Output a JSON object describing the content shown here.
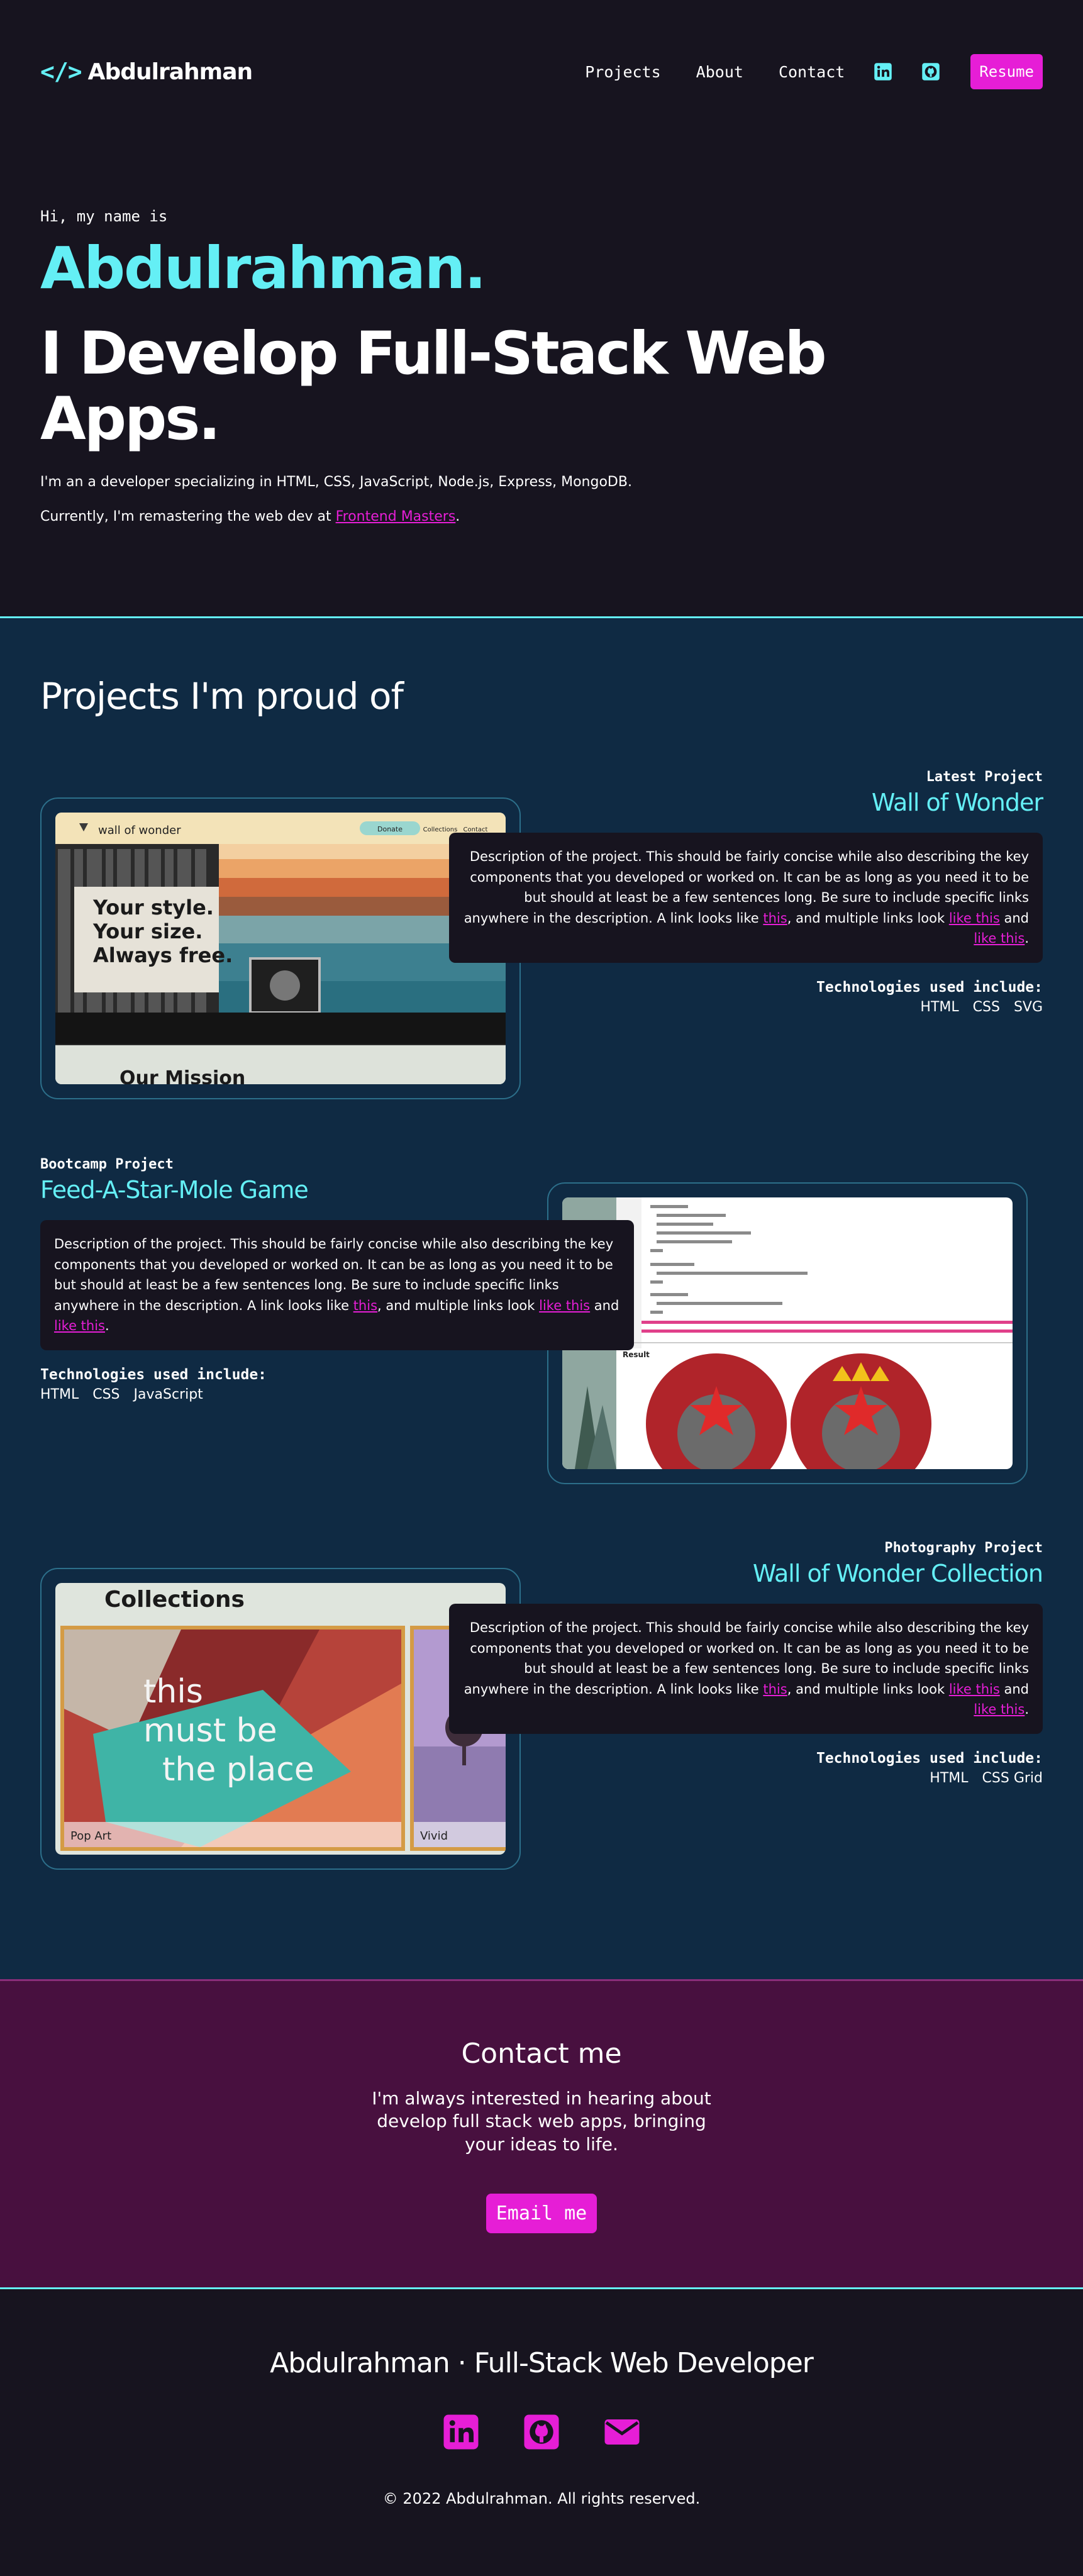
{
  "nav": {
    "logo_text": "Abdulrahman",
    "links": [
      "Projects",
      "About",
      "Contact"
    ],
    "resume_label": "Resume",
    "icons": [
      "linkedin-icon",
      "github-icon"
    ],
    "accent": "#64eff5",
    "brand": "#e61ed6"
  },
  "hero": {
    "greeting": "Hi, my name is",
    "name": "Abdulrahman.",
    "tagline": "I Develop Full-Stack Web Apps.",
    "intro": "I'm an a developer specializing in HTML, CSS, JavaScript, Node.js, Express, MongoDB.",
    "current_prefix": "Currently, I'm remastering the web dev at ",
    "current_link": "Frontend Masters",
    "current_suffix": "."
  },
  "projects": {
    "heading": "Projects I'm proud of",
    "desc_text": "Description of the project. This should be fairly concise while also describing the key components that you developed or worked on. It can be as long as you need it to be but should at least be a few sentences long. Be sure to include specific links anywhere in the description. A link looks like ",
    "desc_link1": "this",
    "desc_mid": ", and multiple links look ",
    "desc_link2": "like this",
    "desc_and": " and ",
    "desc_link3": "like this",
    "desc_end": ".",
    "tech_heading": "Technologies used include:",
    "items": [
      {
        "kind": "Latest Project",
        "title": "Wall of Wonder",
        "tech": [
          "HTML",
          "CSS",
          "SVG"
        ],
        "shot": {
          "brand": "wall of wonder",
          "donate": "Donate",
          "nav1": "Collections",
          "nav2": "Contact",
          "headline1": "Your style.",
          "headline2": "Your size.",
          "headline3": "Always free.",
          "mission": "Our Mission"
        }
      },
      {
        "kind": "Bootcamp Project",
        "title": "Feed-A-Star-Mole Game",
        "tech": [
          "HTML",
          "CSS",
          "JavaScript"
        ],
        "shot": {
          "result_label": "Result"
        }
      },
      {
        "kind": "Photography Project",
        "title": "Wall of Wonder Collection",
        "tech": [
          "HTML",
          "CSS Grid"
        ],
        "shot": {
          "heading": "Collections",
          "neon1": "this",
          "neon2": "must be",
          "neon3": "the place",
          "caption1": "Pop Art",
          "caption2": "Vivid"
        }
      }
    ]
  },
  "contact": {
    "heading": "Contact me",
    "text": "I'm always interested in hearing about develop full stack web apps, bringing your ideas to life.",
    "button": "Email me"
  },
  "footer": {
    "title": "Abdulrahman · Full-Stack Web Developer",
    "icons": [
      "linkedin-icon",
      "github-icon",
      "mail-icon"
    ],
    "copyright": "© 2022 Abdulrahman. All rights reserved."
  }
}
